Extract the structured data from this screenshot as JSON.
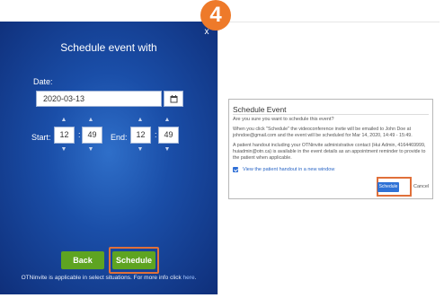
{
  "step": {
    "number": "4"
  },
  "left": {
    "close": "x",
    "title": "Schedule event with",
    "date": {
      "label": "Date:",
      "value": "2020-03-13"
    },
    "start": {
      "label": "Start:",
      "hour": "12",
      "minute": "49"
    },
    "end": {
      "label": "End:",
      "hour": "12",
      "minute": "49"
    },
    "time_separator": ":",
    "back_label": "Back",
    "schedule_label": "Schedule",
    "footnote": "OTNinvite is applicable in select situations. For more info click",
    "footnote_link": "here",
    "footnote_end": "."
  },
  "dialog": {
    "title": "Schedule Event",
    "question": "Are you sure you want to schedule this event?",
    "paragraph1": "When you click \"Schedule\" the videoconference invite will be emailed to John Doe at johndoe@gmail.com and the event will be scheduled for Mar 14, 2020, 14:49 - 15:49.",
    "paragraph2": "A patient handout including your OTNinvite administrative contact (Hui Admin, 4164469999, huiadmin@otn.ca) is available in the event details as an appointment reminder to provide to the patient when applicable.",
    "handout_link": "View the patient handout in a new window",
    "schedule_label": "Schedule",
    "cancel_label": "Cancel"
  },
  "colors": {
    "panel_blue": "#1a4ea8",
    "button_green": "#5ea421",
    "highlight_orange": "#e0703a",
    "badge_orange": "#ee7a2a",
    "dialog_button_blue": "#2f72d6"
  }
}
